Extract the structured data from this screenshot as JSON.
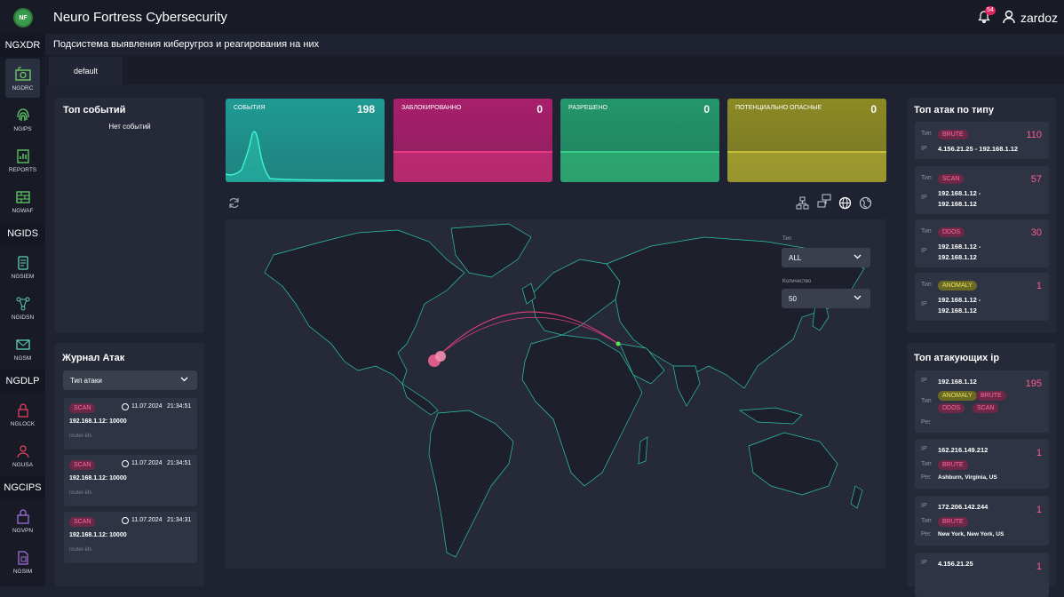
{
  "app": {
    "logo": "NF",
    "title": "Neuro Fortress Cybersecurity",
    "subtitle": "Подсистема выявления киберугроз и реагирования на них",
    "notifications": "54",
    "user": "zardoz",
    "tab": "default"
  },
  "sidebar": {
    "groups": [
      "NGXDR",
      "NGIDS",
      "NGDLP",
      "NGCIPS"
    ],
    "items": [
      {
        "label": "NGDRC",
        "icon": "radar-icon"
      },
      {
        "label": "NGIPS",
        "icon": "fingerprint-icon"
      },
      {
        "label": "REPORTS",
        "icon": "report-icon"
      },
      {
        "label": "NGWAF",
        "icon": "firewall-icon"
      },
      {
        "label": "NGSIEM",
        "icon": "siem-icon"
      },
      {
        "label": "NGIDSN",
        "icon": "network-icon"
      },
      {
        "label": "NGSM",
        "icon": "mail-icon"
      },
      {
        "label": "NGLOCK",
        "icon": "lock-icon"
      },
      {
        "label": "NGUSA",
        "icon": "user-analytics-icon"
      },
      {
        "label": "NGVPN",
        "icon": "vpn-icon"
      },
      {
        "label": "NGSIM",
        "icon": "sim-icon"
      }
    ]
  },
  "top_events": {
    "title": "Топ событий",
    "empty": "Нет событий"
  },
  "stats": [
    {
      "label": "СОБЫТИЯ",
      "value": "198",
      "color": "#1f9a93"
    },
    {
      "label": "ЗАБЛОКИРОВАННО",
      "value": "0",
      "color": "#a81f6b"
    },
    {
      "label": "РАЗРЕШЕНО",
      "value": "0",
      "color": "#23966a"
    },
    {
      "label": "ПОТЕНЦИАЛЬНО ОПАСНЫЕ",
      "value": "0",
      "color": "#8c8a24"
    }
  ],
  "map_filters": {
    "type_label": "Тип",
    "type_value": "ALL",
    "count_label": "Количество",
    "count_value": "50"
  },
  "log": {
    "title": "Журнал Атак",
    "filter": "Тип атаки",
    "entries": [
      {
        "tag": "SCAN",
        "date": "11.07.2024",
        "time": "21:34:51",
        "addr": "192.168.1.12: 10000",
        "source": "router-ids"
      },
      {
        "tag": "SCAN",
        "date": "11.07.2024",
        "time": "21:34:51",
        "addr": "192.168.1.12: 10000",
        "source": "router-ids"
      },
      {
        "tag": "SCAN",
        "date": "11.07.2024",
        "time": "21:34:31",
        "addr": "192.168.1.12: 10000",
        "source": "router-ids"
      }
    ]
  },
  "top_types": {
    "title": "Топ атак по типу",
    "type_key": "Тип",
    "ip_key": "IP",
    "items": [
      {
        "type": "BRUTE",
        "count": "110",
        "ip": "4.156.21.25 - 192.168.1.12"
      },
      {
        "type": "SCAN",
        "count": "57",
        "ip": "192.168.1.12 -",
        "ip2": "192.168.1.12"
      },
      {
        "type": "DDOS",
        "count": "30",
        "ip": "192.168.1.12 -",
        "ip2": "192.168.1.12"
      },
      {
        "type": "ANOMALY",
        "count": "1",
        "ip": "192.168.1.12 -",
        "ip2": "192.168.1.12"
      }
    ]
  },
  "top_ips": {
    "title": "Топ атакующих ip",
    "ip_key": "IP",
    "type_key": "Тип",
    "reg_key": "Рег.",
    "items": [
      {
        "ip": "192.168.1.12",
        "count": "195",
        "tags": [
          "ANOMALY",
          "BRUTE",
          "DDOS",
          "SCAN"
        ],
        "region": ""
      },
      {
        "ip": "162.216.149.212",
        "count": "1",
        "tags": [
          "BRUTE"
        ],
        "region": "Ashburn, Virginia, US"
      },
      {
        "ip": "172.206.142.244",
        "count": "1",
        "tags": [
          "BRUTE"
        ],
        "region": "New York, New York, US"
      },
      {
        "ip": "4.156.21.25",
        "count": "1",
        "tags": [],
        "region": ""
      }
    ]
  }
}
